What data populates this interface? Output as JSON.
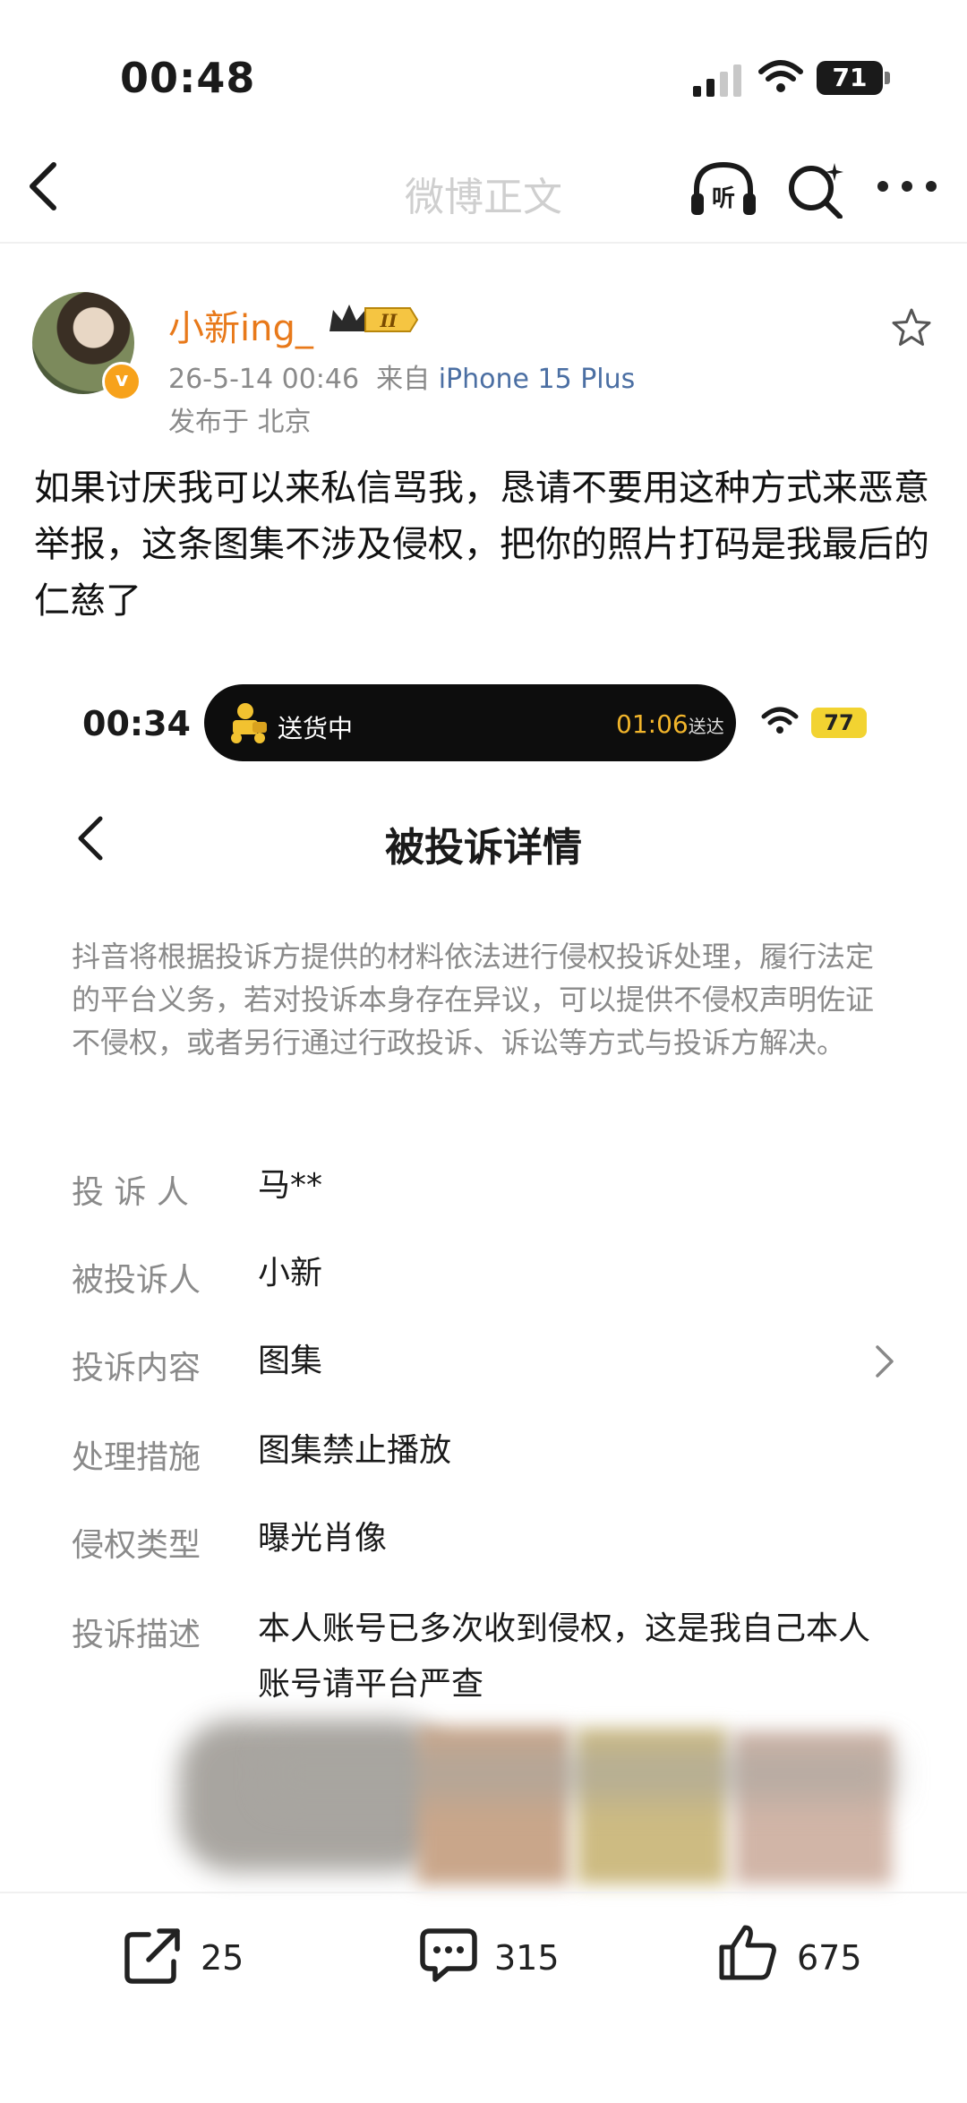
{
  "status_bar": {
    "time": "00:48",
    "battery": "71"
  },
  "nav": {
    "title": "微博正文",
    "listen_glyph": "听"
  },
  "post": {
    "username": "小新ing_",
    "vip_level": "II",
    "verified_glyph": "v",
    "date": "26-5-14 00:46",
    "source_prefix": "来自",
    "device": "iPhone 15 Plus",
    "location": "发布于 北京",
    "text": "如果讨厌我可以来私信骂我，恳请不要用这种方式来恶意举报，这条图集不涉及侵权，把你的照片打码是我最后的仁慈了"
  },
  "embedded": {
    "time": "00:34",
    "pill_left": "送货中",
    "pill_right_time": "01:06",
    "pill_right_suffix": "送达",
    "battery": "77",
    "title": "被投诉详情",
    "notice": "抖音将根据投诉方提供的材料依法进行侵权投诉处理，履行法定的平台义务，若对投诉本身存在异议，可以提供不侵权声明佐证不侵权，或者另行通过行政投诉、诉讼等方式与投诉方解决。",
    "rows": [
      {
        "label": "投 诉 人",
        "value": "马**"
      },
      {
        "label": "被投诉人",
        "value": "小新"
      },
      {
        "label": "投诉内容",
        "value": "图集"
      },
      {
        "label": "处理措施",
        "value": "图集禁止播放"
      },
      {
        "label": "侵权类型",
        "value": "曝光肖像"
      },
      {
        "label": "投诉描述",
        "value": "本人账号已多次收到侵权，这是我自己本人账号请平台严查"
      }
    ]
  },
  "actions": {
    "repost_count": "25",
    "comment_count": "315",
    "like_count": "675"
  }
}
